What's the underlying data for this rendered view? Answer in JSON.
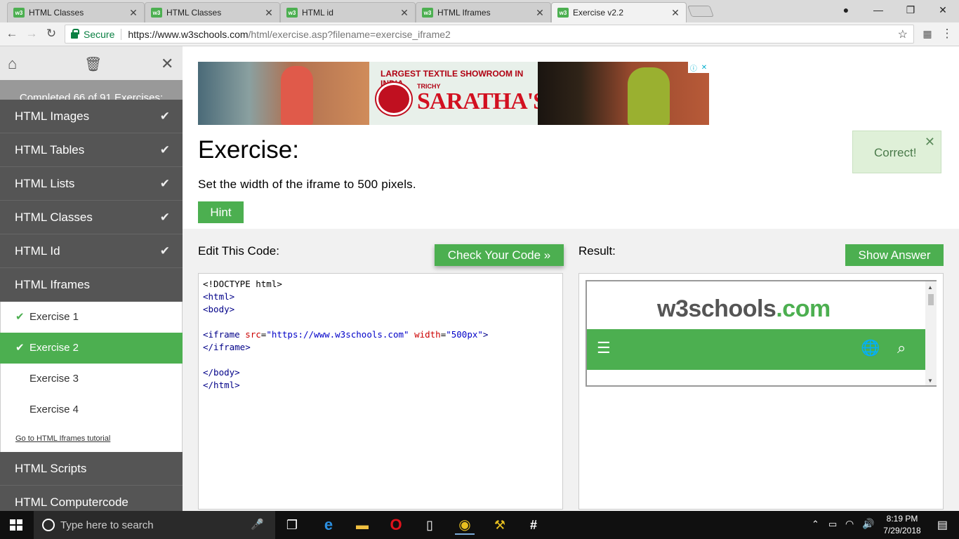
{
  "browser": {
    "tabs": [
      {
        "label": "HTML Classes",
        "favicon": "w3"
      },
      {
        "label": "HTML Classes",
        "favicon": "w3"
      },
      {
        "label": "HTML id",
        "favicon": "w3"
      },
      {
        "label": "HTML Iframes",
        "favicon": "w3"
      },
      {
        "label": "Exercise v2.2",
        "favicon": "w3",
        "active": true
      }
    ],
    "secure_label": "Secure",
    "url_host": "https://www.w3schools.com",
    "url_path": "/html/exercise.asp?filename=exercise_iframe2"
  },
  "sidebar": {
    "progress": "Completed 66 of 91 Exercises:",
    "items": [
      {
        "label": "HTML Images",
        "done": true
      },
      {
        "label": "HTML Tables",
        "done": true
      },
      {
        "label": "HTML Lists",
        "done": true
      },
      {
        "label": "HTML Classes",
        "done": true
      },
      {
        "label": "HTML Id",
        "done": true
      },
      {
        "label": "HTML Iframes",
        "done": false
      }
    ],
    "exercises": [
      {
        "label": "Exercise 1",
        "done": true
      },
      {
        "label": "Exercise 2",
        "done": true,
        "active": true
      },
      {
        "label": "Exercise 3",
        "done": false
      },
      {
        "label": "Exercise 4",
        "done": false
      }
    ],
    "tutorial_link": "Go to HTML Iframes tutorial",
    "after_items": [
      {
        "label": "HTML Scripts"
      },
      {
        "label": "HTML Computercode"
      }
    ]
  },
  "ad": {
    "headline": "LARGEST TEXTILE SHOWROOM IN INDIA",
    "city": "TRICHY",
    "brand": "SARATHA'S"
  },
  "exercise": {
    "title": "Exercise:",
    "description": "Set the width of the iframe to 500 pixels.",
    "hint_label": "Hint",
    "feedback": "Correct!",
    "edit_label": "Edit This Code:",
    "check_label": "Check Your Code »",
    "result_label": "Result:",
    "answer_label": "Show Answer",
    "code": {
      "doctype": "<!DOCTYPE html>",
      "html_open": "<html>",
      "body_open": "<body>",
      "iframe_tag": "<iframe",
      "src_attr": "src",
      "src_val": "\"https://www.w3schools.com\"",
      "width_attr": "width",
      "width_val": "\"500px\"",
      "iframe_close_bracket": ">",
      "iframe_end": "</iframe>",
      "body_close": "</body>",
      "html_close": "</html>"
    }
  },
  "result_frame": {
    "logo_main": "w3schools",
    "logo_suffix": ".com"
  },
  "taskbar": {
    "search_placeholder": "Type here to search",
    "time": "8:19 PM",
    "date": "7/29/2018"
  },
  "colors": {
    "accent": "#4caf50",
    "sidebar": "#555555",
    "feedback_bg": "#dff0d8"
  }
}
